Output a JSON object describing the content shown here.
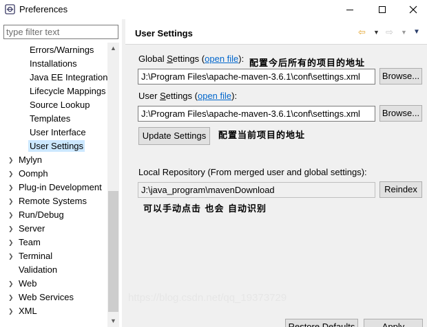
{
  "window": {
    "title": "Preferences"
  },
  "filter": {
    "placeholder": "type filter text",
    "value": ""
  },
  "tree": {
    "children": [
      {
        "label": "Errors/Warnings"
      },
      {
        "label": "Installations"
      },
      {
        "label": "Java EE Integration"
      },
      {
        "label": "Lifecycle Mappings"
      },
      {
        "label": "Source Lookup"
      },
      {
        "label": "Templates"
      },
      {
        "label": "User Interface"
      },
      {
        "label": "User Settings",
        "selected": true
      }
    ],
    "top": [
      {
        "label": "Mylyn",
        "expandable": true
      },
      {
        "label": "Oomph",
        "expandable": true
      },
      {
        "label": "Plug-in Development",
        "expandable": true
      },
      {
        "label": "Remote Systems",
        "expandable": true
      },
      {
        "label": "Run/Debug",
        "expandable": true
      },
      {
        "label": "Server",
        "expandable": true
      },
      {
        "label": "Team",
        "expandable": true
      },
      {
        "label": "Terminal",
        "expandable": true
      },
      {
        "label": "Validation",
        "expandable": false
      },
      {
        "label": "Web",
        "expandable": true
      },
      {
        "label": "Web Services",
        "expandable": true
      },
      {
        "label": "XML",
        "expandable": true
      }
    ]
  },
  "page": {
    "title": "User Settings",
    "global": {
      "label_prefix": "Global ",
      "label_mnemonic": "S",
      "label_suffix": "ettings (",
      "link": "open file",
      "label_end": "):",
      "annotation": "配置今后所有的项目的地址",
      "value": "J:\\Program Files\\apache-maven-3.6.1\\conf\\settings.xml",
      "browse": "Browse..."
    },
    "user": {
      "label_prefix": "User ",
      "label_mnemonic": "S",
      "label_suffix": "ettings (",
      "link": "open file",
      "label_end": "):",
      "value": "J:\\Program Files\\apache-maven-3.6.1\\conf\\settings.xml",
      "browse": "Browse...",
      "annotation": "配置当前项目的地址"
    },
    "update_button": "Update Settings",
    "local": {
      "label": "Local Repository (From merged user and global settings):",
      "value": "J:\\java_program\\mavenDownload",
      "reindex": "Reindex",
      "annotation": "可以手动点击 也会 自动识别"
    },
    "watermark": "https://blog.csdn.net/qq_19373729",
    "restore_defaults": "Restore Defaults",
    "apply": "Apply"
  },
  "icons": {
    "nav_back": "back-arrow-icon",
    "nav_forward": "forward-arrow-icon",
    "nav_menu": "view-menu-icon",
    "tree_expand": "chevron-right-icon"
  },
  "colors": {
    "selection": "#cce8ff",
    "link": "#0066cc",
    "nav_back": "#e3a32b"
  }
}
